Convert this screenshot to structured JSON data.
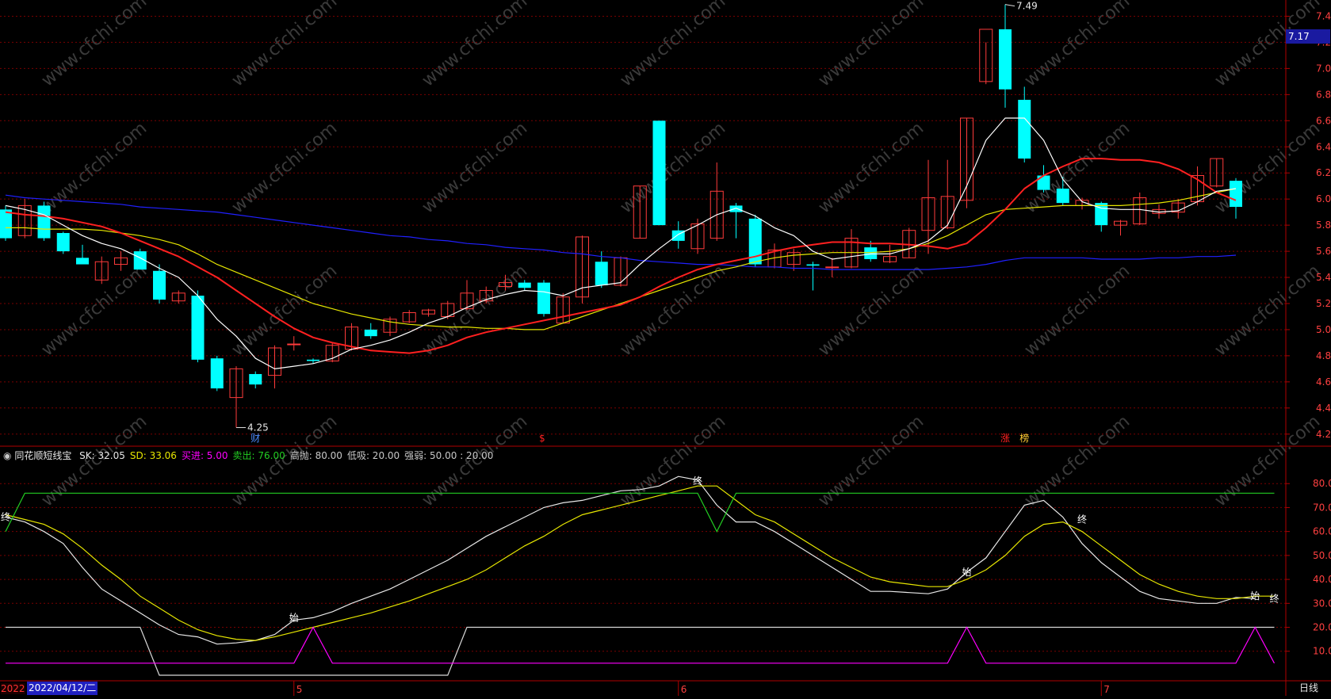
{
  "colors": {
    "up": "#ff3b3b",
    "down": "#00ffff",
    "ma5": "#ffffff",
    "ma10": "#ff2020",
    "ma20": "#e6e600",
    "ma60": "#2020ff",
    "grid": "#7a0000",
    "axis": "#b00000",
    "green": "#22cc22",
    "magenta": "#ff00ff",
    "ticktext": "#ff4040"
  },
  "chart_data": [
    {
      "type": "candlestick",
      "ylim": [
        4.15,
        7.5
      ],
      "y_ticks": [
        "7.40",
        "7.20",
        "7.00",
        "6.80",
        "6.60",
        "6.40",
        "6.20",
        "6.00",
        "5.80",
        "5.60",
        "5.40",
        "5.20",
        "5.00",
        "4.80",
        "4.60",
        "4.40",
        "4.20"
      ],
      "current_price": "7.17",
      "high_marker": "7.49",
      "low_marker": "4.25",
      "candles": [
        {
          "o": 5.92,
          "h": 5.95,
          "l": 5.68,
          "c": 5.7
        },
        {
          "o": 5.72,
          "h": 6.0,
          "l": 5.7,
          "c": 5.95
        },
        {
          "o": 5.95,
          "h": 5.98,
          "l": 5.68,
          "c": 5.7
        },
        {
          "o": 5.74,
          "h": 5.75,
          "l": 5.58,
          "c": 5.6
        },
        {
          "o": 5.55,
          "h": 5.65,
          "l": 5.5,
          "c": 5.5
        },
        {
          "o": 5.38,
          "h": 5.56,
          "l": 5.35,
          "c": 5.52
        },
        {
          "o": 5.5,
          "h": 5.6,
          "l": 5.45,
          "c": 5.55
        },
        {
          "o": 5.6,
          "h": 5.62,
          "l": 5.46,
          "c": 5.46
        },
        {
          "o": 5.45,
          "h": 5.5,
          "l": 5.2,
          "c": 5.23
        },
        {
          "o": 5.22,
          "h": 5.3,
          "l": 5.2,
          "c": 5.28
        },
        {
          "o": 5.26,
          "h": 5.3,
          "l": 4.75,
          "c": 4.77
        },
        {
          "o": 4.78,
          "h": 4.8,
          "l": 4.53,
          "c": 4.55
        },
        {
          "o": 4.48,
          "h": 4.72,
          "l": 4.25,
          "c": 4.7
        },
        {
          "o": 4.66,
          "h": 4.68,
          "l": 4.55,
          "c": 4.58
        },
        {
          "o": 4.65,
          "h": 4.88,
          "l": 4.55,
          "c": 4.86
        },
        {
          "o": 4.89,
          "h": 4.95,
          "l": 4.84,
          "c": 4.89
        },
        {
          "o": 4.77,
          "h": 4.78,
          "l": 4.74,
          "c": 4.76
        },
        {
          "o": 4.76,
          "h": 4.9,
          "l": 4.75,
          "c": 4.88
        },
        {
          "o": 4.85,
          "h": 5.05,
          "l": 4.84,
          "c": 5.02
        },
        {
          "o": 5.0,
          "h": 5.05,
          "l": 4.93,
          "c": 4.95
        },
        {
          "o": 4.98,
          "h": 5.1,
          "l": 4.95,
          "c": 5.08
        },
        {
          "o": 5.06,
          "h": 5.15,
          "l": 5.05,
          "c": 5.13
        },
        {
          "o": 5.12,
          "h": 5.16,
          "l": 5.1,
          "c": 5.15
        },
        {
          "o": 5.1,
          "h": 5.22,
          "l": 5.08,
          "c": 5.2
        },
        {
          "o": 5.16,
          "h": 5.38,
          "l": 5.15,
          "c": 5.28
        },
        {
          "o": 5.22,
          "h": 5.33,
          "l": 5.2,
          "c": 5.3
        },
        {
          "o": 5.33,
          "h": 5.42,
          "l": 5.3,
          "c": 5.36
        },
        {
          "o": 5.36,
          "h": 5.38,
          "l": 5.3,
          "c": 5.32
        },
        {
          "o": 5.36,
          "h": 5.38,
          "l": 5.1,
          "c": 5.12
        },
        {
          "o": 5.05,
          "h": 5.28,
          "l": 5.05,
          "c": 5.25
        },
        {
          "o": 5.25,
          "h": 5.72,
          "l": 5.2,
          "c": 5.71
        },
        {
          "o": 5.52,
          "h": 5.6,
          "l": 5.32,
          "c": 5.34
        },
        {
          "o": 5.34,
          "h": 5.56,
          "l": 5.33,
          "c": 5.55
        },
        {
          "o": 5.7,
          "h": 6.1,
          "l": 5.7,
          "c": 6.1
        },
        {
          "o": 6.6,
          "h": 6.6,
          "l": 5.8,
          "c": 5.8
        },
        {
          "o": 5.76,
          "h": 5.83,
          "l": 5.62,
          "c": 5.68
        },
        {
          "o": 5.62,
          "h": 5.85,
          "l": 5.58,
          "c": 5.81
        },
        {
          "o": 5.7,
          "h": 6.28,
          "l": 5.68,
          "c": 6.06
        },
        {
          "o": 5.95,
          "h": 5.97,
          "l": 5.7,
          "c": 5.9
        },
        {
          "o": 5.85,
          "h": 5.88,
          "l": 5.48,
          "c": 5.5
        },
        {
          "o": 5.48,
          "h": 5.66,
          "l": 5.47,
          "c": 5.61
        },
        {
          "o": 5.5,
          "h": 5.62,
          "l": 5.45,
          "c": 5.59
        },
        {
          "o": 5.5,
          "h": 5.52,
          "l": 5.3,
          "c": 5.49
        },
        {
          "o": 5.48,
          "h": 5.55,
          "l": 5.4,
          "c": 5.48
        },
        {
          "o": 5.48,
          "h": 5.77,
          "l": 5.47,
          "c": 5.7
        },
        {
          "o": 5.63,
          "h": 5.68,
          "l": 5.52,
          "c": 5.54
        },
        {
          "o": 5.52,
          "h": 5.65,
          "l": 5.51,
          "c": 5.56
        },
        {
          "o": 5.55,
          "h": 5.78,
          "l": 5.55,
          "c": 5.76
        },
        {
          "o": 5.76,
          "h": 6.3,
          "l": 5.58,
          "c": 6.01
        },
        {
          "o": 5.78,
          "h": 6.3,
          "l": 5.77,
          "c": 6.02
        },
        {
          "o": 5.99,
          "h": 6.62,
          "l": 5.93,
          "c": 6.62
        },
        {
          "o": 6.9,
          "h": 7.2,
          "l": 6.88,
          "c": 7.3
        },
        {
          "o": 7.3,
          "h": 7.49,
          "l": 6.7,
          "c": 6.84
        },
        {
          "o": 6.76,
          "h": 6.86,
          "l": 6.28,
          "c": 6.31
        },
        {
          "o": 6.18,
          "h": 6.26,
          "l": 6.05,
          "c": 6.07
        },
        {
          "o": 6.08,
          "h": 6.17,
          "l": 5.95,
          "c": 5.97
        },
        {
          "o": 5.95,
          "h": 6.01,
          "l": 5.92,
          "c": 5.99
        },
        {
          "o": 5.97,
          "h": 5.98,
          "l": 5.75,
          "c": 5.8
        },
        {
          "o": 5.8,
          "h": 5.84,
          "l": 5.72,
          "c": 5.83
        },
        {
          "o": 5.81,
          "h": 6.05,
          "l": 5.8,
          "c": 6.01
        },
        {
          "o": 5.89,
          "h": 5.96,
          "l": 5.85,
          "c": 5.92
        },
        {
          "o": 5.9,
          "h": 6.0,
          "l": 5.85,
          "c": 5.97
        },
        {
          "o": 5.98,
          "h": 6.25,
          "l": 5.95,
          "c": 6.18
        },
        {
          "o": 6.1,
          "h": 6.31,
          "l": 6.09,
          "c": 6.31
        },
        {
          "o": 6.14,
          "h": 6.16,
          "l": 5.85,
          "c": 5.94
        }
      ],
      "ma5": [
        5.95,
        5.92,
        5.88,
        5.8,
        5.72,
        5.66,
        5.62,
        5.55,
        5.47,
        5.4,
        5.26,
        5.08,
        4.95,
        4.78,
        4.7,
        4.72,
        4.74,
        4.78,
        4.85,
        4.88,
        4.92,
        4.98,
        5.05,
        5.1,
        5.17,
        5.23,
        5.27,
        5.3,
        5.29,
        5.26,
        5.32,
        5.34,
        5.36,
        5.5,
        5.62,
        5.73,
        5.8,
        5.88,
        5.93,
        5.87,
        5.78,
        5.72,
        5.6,
        5.54,
        5.56,
        5.58,
        5.58,
        5.62,
        5.68,
        5.8,
        6.1,
        6.45,
        6.62,
        6.62,
        6.45,
        6.15,
        5.98,
        5.93,
        5.92,
        5.92,
        5.9,
        5.91,
        5.98,
        6.06,
        6.08
      ],
      "ma10": [
        5.9,
        5.88,
        5.87,
        5.85,
        5.82,
        5.79,
        5.74,
        5.68,
        5.62,
        5.56,
        5.48,
        5.4,
        5.3,
        5.2,
        5.1,
        5.01,
        4.94,
        4.9,
        4.87,
        4.84,
        4.83,
        4.82,
        4.84,
        4.88,
        4.94,
        4.98,
        5.01,
        5.04,
        5.07,
        5.1,
        5.13,
        5.16,
        5.19,
        5.25,
        5.33,
        5.4,
        5.46,
        5.5,
        5.53,
        5.56,
        5.6,
        5.63,
        5.65,
        5.67,
        5.67,
        5.66,
        5.66,
        5.65,
        5.64,
        5.62,
        5.66,
        5.78,
        5.92,
        6.08,
        6.18,
        6.25,
        6.31,
        6.31,
        6.3,
        6.3,
        6.28,
        6.23,
        6.15,
        6.05,
        5.99
      ],
      "ma20": [
        5.78,
        5.78,
        5.77,
        5.77,
        5.77,
        5.76,
        5.74,
        5.72,
        5.69,
        5.65,
        5.58,
        5.5,
        5.44,
        5.38,
        5.32,
        5.26,
        5.2,
        5.16,
        5.12,
        5.09,
        5.06,
        5.04,
        5.03,
        5.02,
        5.02,
        5.01,
        5.01,
        5.0,
        5.0,
        5.05,
        5.1,
        5.15,
        5.2,
        5.25,
        5.3,
        5.35,
        5.4,
        5.45,
        5.48,
        5.52,
        5.55,
        5.57,
        5.58,
        5.59,
        5.59,
        5.59,
        5.6,
        5.62,
        5.66,
        5.72,
        5.8,
        5.88,
        5.92,
        5.93,
        5.94,
        5.95,
        5.95,
        5.95,
        5.95,
        5.96,
        5.97,
        5.99,
        6.02,
        6.05,
        6.08
      ],
      "ma60": [
        6.03,
        6.01,
        6.0,
        5.99,
        5.98,
        5.97,
        5.96,
        5.94,
        5.93,
        5.92,
        5.91,
        5.9,
        5.88,
        5.86,
        5.84,
        5.82,
        5.8,
        5.78,
        5.76,
        5.74,
        5.72,
        5.71,
        5.69,
        5.68,
        5.66,
        5.65,
        5.63,
        5.62,
        5.61,
        5.59,
        5.58,
        5.56,
        5.55,
        5.53,
        5.52,
        5.51,
        5.5,
        5.5,
        5.49,
        5.48,
        5.48,
        5.47,
        5.47,
        5.46,
        5.46,
        5.46,
        5.46,
        5.46,
        5.46,
        5.47,
        5.48,
        5.5,
        5.53,
        5.55,
        5.55,
        5.55,
        5.55,
        5.54,
        5.54,
        5.54,
        5.55,
        5.55,
        5.56,
        5.56,
        5.57
      ],
      "event_labels": [
        {
          "index": 13,
          "text": "财",
          "color": "#4a8bff"
        },
        {
          "index": 28,
          "text": "$",
          "color": "#ff2020"
        },
        {
          "index": 52,
          "text": "涨",
          "color": "#ff2020"
        },
        {
          "index": 53,
          "text": "榜",
          "color": "#ffcc33"
        }
      ]
    },
    {
      "type": "line",
      "title": "同花顺短线宝",
      "params": [
        {
          "text": "SK: 32.05",
          "color": "#e8e8e8"
        },
        {
          "text": "SD: 33.06",
          "color": "#e6e600"
        },
        {
          "text": "买进: 5.00",
          "color": "#ff00ff"
        },
        {
          "text": "卖出: 76.00",
          "color": "#22cc22"
        },
        {
          "text": "高抛: 80.00",
          "color": "#c8c8c8"
        },
        {
          "text": "低吸: 20.00",
          "color": "#c8c8c8"
        },
        {
          "text": "强弱: 50.00 : 20.00",
          "color": "#c8c8c8"
        }
      ],
      "ylim": [
        -2,
        90
      ],
      "y_ticks": [
        "80.00",
        "70.00",
        "60.00",
        "50.00",
        "40.00",
        "30.00",
        "20.00",
        "10.00"
      ],
      "series": [
        {
          "name": "SK",
          "values": [
            66,
            64,
            60,
            55,
            45,
            36,
            31,
            26,
            21,
            17,
            16,
            13,
            13.5,
            14.5,
            17,
            23,
            24,
            26.5,
            30,
            33,
            36,
            40,
            44,
            48,
            53,
            58,
            62,
            66,
            70,
            72,
            73,
            75,
            77,
            77.5,
            79,
            83,
            81.5,
            71,
            64,
            64,
            60,
            55,
            50,
            45,
            40,
            35,
            35,
            34.5,
            34,
            36,
            43,
            49,
            60,
            71,
            73,
            66,
            55,
            47,
            41,
            35,
            32,
            31,
            30,
            30,
            32.5,
            32
          ]
        },
        {
          "name": "SD",
          "values": [
            67,
            65,
            63,
            59,
            53,
            46,
            40,
            33,
            28,
            23,
            19,
            16.5,
            15,
            14.5,
            16,
            18,
            20,
            22,
            24,
            26,
            28.5,
            31,
            34,
            37,
            40,
            44,
            49,
            54,
            58,
            63,
            67,
            69,
            71,
            73,
            75,
            77,
            79,
            79,
            73,
            67,
            64,
            59,
            54,
            49,
            45,
            41,
            39,
            38,
            37,
            37,
            40,
            44,
            50,
            58,
            63,
            64,
            60,
            54,
            48,
            42,
            38,
            35,
            33,
            32,
            32,
            33,
            33
          ]
        },
        {
          "name": "卖出",
          "values": [
            60,
            76,
            76,
            76,
            76,
            76,
            76,
            76,
            76,
            76,
            76,
            76,
            76,
            76,
            76,
            76,
            76,
            76,
            76,
            76,
            76,
            76,
            76,
            76,
            76,
            76,
            76,
            76,
            76,
            76,
            76,
            76,
            76,
            76,
            76,
            76,
            76,
            60,
            76,
            76,
            76,
            76,
            76,
            76,
            76,
            76,
            76,
            76,
            76,
            76,
            76,
            76,
            76,
            76,
            76,
            76,
            76,
            76,
            76,
            76,
            76,
            76,
            76,
            76,
            76,
            76,
            76
          ]
        },
        {
          "name": "高抛",
          "values": [
            20,
            20,
            20,
            20,
            20,
            20,
            20,
            20,
            0,
            0,
            0,
            0,
            0,
            0,
            0,
            0,
            0,
            0,
            0,
            0,
            0,
            0,
            0,
            0,
            20,
            20,
            20,
            20,
            20,
            20,
            20,
            20,
            20,
            20,
            20,
            20,
            20,
            20,
            20,
            20,
            20,
            20,
            20,
            20,
            20,
            20,
            20,
            20,
            20,
            20,
            20,
            20,
            20,
            20,
            20,
            20,
            20,
            20,
            20,
            20,
            20,
            20,
            20,
            20,
            20,
            20,
            20
          ]
        },
        {
          "name": "买进",
          "values": [
            5,
            5,
            5,
            5,
            5,
            5,
            5,
            5,
            5,
            5,
            5,
            5,
            5,
            5,
            5,
            5,
            20,
            5,
            5,
            5,
            5,
            5,
            5,
            5,
            5,
            5,
            5,
            5,
            5,
            5,
            5,
            5,
            5,
            5,
            5,
            5,
            5,
            5,
            5,
            5,
            5,
            5,
            5,
            5,
            5,
            5,
            5,
            5,
            5,
            5,
            20,
            5,
            5,
            5,
            5,
            5,
            5,
            5,
            5,
            5,
            5,
            5,
            5,
            5,
            5,
            20,
            5
          ]
        }
      ],
      "markers": [
        {
          "index": 0,
          "value": 66,
          "text": "终"
        },
        {
          "index": 15,
          "value": 24,
          "text": "始"
        },
        {
          "index": 36,
          "value": 81,
          "text": "终"
        },
        {
          "index": 50,
          "value": 43,
          "text": "始"
        },
        {
          "index": 56,
          "value": 65,
          "text": "终"
        },
        {
          "index": 65,
          "value": 33,
          "text": "始"
        },
        {
          "index": 66,
          "value": 32,
          "text": "终"
        }
      ]
    }
  ],
  "x_axis": {
    "date_label": "2022/04/12/二",
    "year_prefix": "2022",
    "month_ticks": [
      {
        "index": 15,
        "text": "5"
      },
      {
        "index": 35,
        "text": "6"
      },
      {
        "index": 57,
        "text": "7"
      }
    ],
    "period": "日线"
  },
  "watermark": "www.cfchi.com"
}
